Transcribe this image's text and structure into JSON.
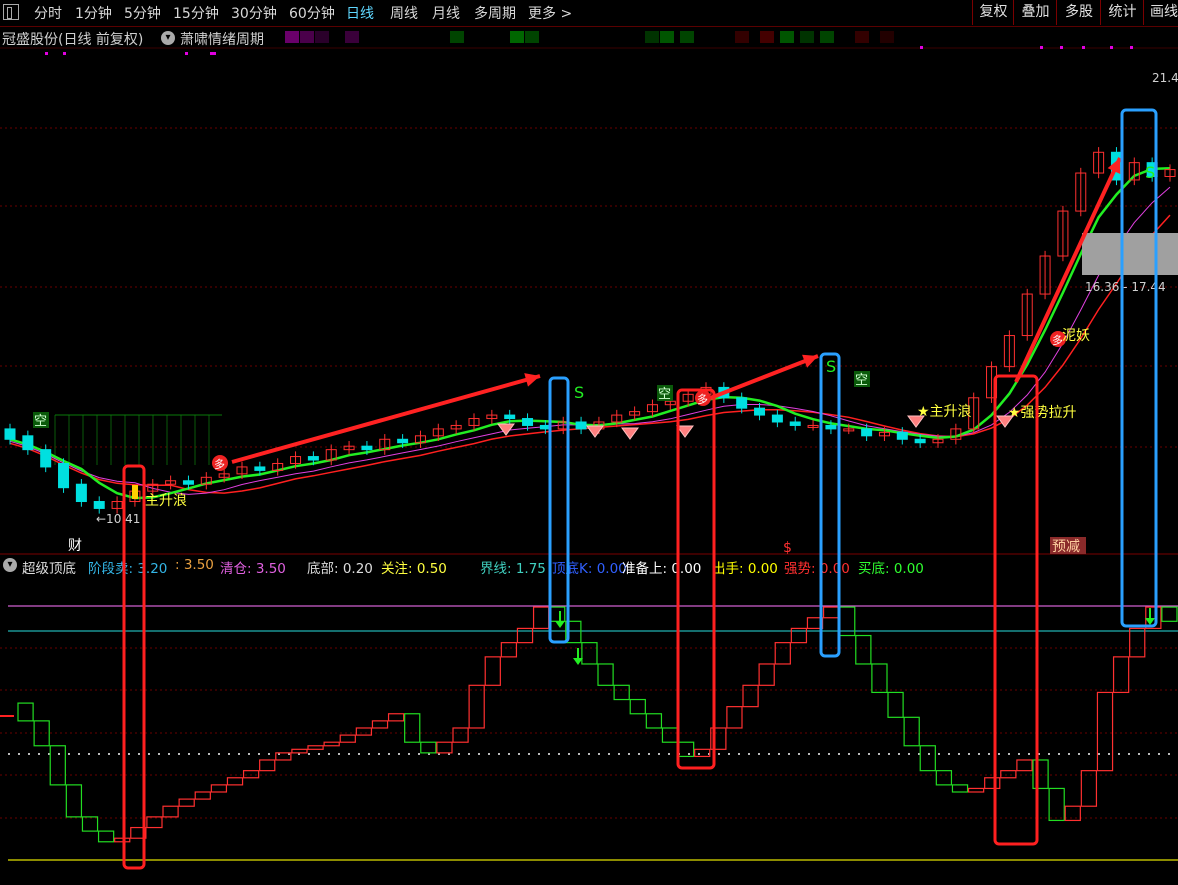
{
  "toolbar": {
    "periods": [
      "分时",
      "1分钟",
      "5分钟",
      "15分钟",
      "30分钟",
      "60分钟",
      "日线",
      "周线",
      "月线",
      "多周期",
      "更多 >"
    ],
    "active_period": "日线",
    "right_buttons": [
      "复权",
      "叠加",
      "多股",
      "统计",
      "画线"
    ]
  },
  "title": {
    "stock": "冠盛股份(日线 前复权)",
    "indicator_name": "萧啸情绪周期"
  },
  "price_panel": {
    "high_label": "21.4",
    "range_label": "16.36 - 17.44",
    "low_label": "←10.41",
    "markers": {
      "cai": "财",
      "dollar": "$",
      "yujian": "预减",
      "kong": "空",
      "duo": "多",
      "s": "S",
      "main_wave": "主升浪",
      "star_main_wave": "★主升浪",
      "strong_up": "★强势拉升",
      "niyao": "泥妖"
    }
  },
  "indicator": {
    "name": "超级顶底",
    "fields": [
      {
        "label": "阶段卖:",
        "value": "3.20",
        "color": "#33b5e5"
      },
      {
        "label": ":",
        "value": "3.50",
        "color": "#e8a040"
      },
      {
        "label": "清仓:",
        "value": "3.50",
        "color": "#e060e0"
      },
      {
        "label": "底部:",
        "value": "0.20",
        "color": "#dddddd"
      },
      {
        "label": "关注:",
        "value": "0.50",
        "color": "#ffff40"
      },
      {
        "label": "界线:",
        "value": "1.75",
        "color": "#40d0c0"
      },
      {
        "label": "顶底K:",
        "value": "0.00",
        "color": "#3060ff"
      },
      {
        "label": "准备上:",
        "value": "0.00",
        "color": "#ffffff"
      },
      {
        "label": "出手:",
        "value": "0.00",
        "color": "#ffff00"
      },
      {
        "label": "强势:",
        "value": "0.00",
        "color": "#ff3030"
      },
      {
        "label": "买底:",
        "value": "0.00",
        "color": "#30ff30"
      }
    ]
  },
  "colors": {
    "up": "#ff3030",
    "down": "#00e0e0",
    "ma_green": "#22ee22",
    "ma_red": "#ff2020",
    "ma_magenta": "#e040e0",
    "box_red": "#ff2020",
    "box_blue": "#2aa0ff",
    "level_magenta": "#d060d0",
    "level_cyan": "#20b0b0",
    "level_yellow": "#e0e000"
  },
  "chart_data": [
    {
      "type": "candlestick",
      "title": "冠盛股份(日线 前复权)",
      "price_range": [
        10.41,
        21.4
      ],
      "series": [
        {
          "name": "candles",
          "values": [
            [
              12.9,
              12.6
            ],
            [
              12.7,
              12.3
            ],
            [
              12.3,
              11.8
            ],
            [
              11.9,
              11.2
            ],
            [
              11.3,
              10.8
            ],
            [
              10.8,
              10.6
            ],
            [
              10.6,
              10.8
            ],
            [
              10.8,
              11.1
            ],
            [
              11.1,
              11.3
            ],
            [
              11.3,
              11.4
            ],
            [
              11.4,
              11.3
            ],
            [
              11.3,
              11.5
            ],
            [
              11.5,
              11.6
            ],
            [
              11.6,
              11.8
            ],
            [
              11.8,
              11.7
            ],
            [
              11.7,
              11.9
            ],
            [
              11.9,
              12.1
            ],
            [
              12.1,
              12.0
            ],
            [
              12.0,
              12.3
            ],
            [
              12.3,
              12.4
            ],
            [
              12.4,
              12.3
            ],
            [
              12.3,
              12.6
            ],
            [
              12.6,
              12.5
            ],
            [
              12.5,
              12.7
            ],
            [
              12.7,
              12.9
            ],
            [
              12.9,
              13.0
            ],
            [
              13.0,
              13.2
            ],
            [
              13.2,
              13.3
            ],
            [
              13.3,
              13.2
            ],
            [
              13.2,
              13.0
            ],
            [
              13.0,
              12.9
            ],
            [
              12.9,
              13.1
            ],
            [
              13.1,
              12.9
            ],
            [
              12.9,
              13.1
            ],
            [
              13.1,
              13.3
            ],
            [
              13.3,
              13.4
            ],
            [
              13.4,
              13.6
            ],
            [
              13.6,
              13.7
            ],
            [
              13.7,
              13.9
            ],
            [
              13.9,
              14.1
            ],
            [
              14.1,
              13.8
            ],
            [
              13.8,
              13.5
            ],
            [
              13.5,
              13.3
            ],
            [
              13.3,
              13.1
            ],
            [
              13.1,
              13.0
            ],
            [
              13.0,
              13.0
            ],
            [
              13.0,
              12.9
            ],
            [
              12.9,
              12.9
            ],
            [
              12.9,
              12.7
            ],
            [
              12.7,
              12.8
            ],
            [
              12.8,
              12.6
            ],
            [
              12.6,
              12.5
            ],
            [
              12.5,
              12.6
            ],
            [
              12.6,
              12.9
            ],
            [
              12.9,
              13.8
            ],
            [
              13.8,
              14.7
            ],
            [
              14.7,
              15.6
            ],
            [
              15.6,
              16.8
            ],
            [
              16.8,
              17.9
            ],
            [
              17.9,
              19.2
            ],
            [
              19.2,
              20.3
            ],
            [
              20.3,
              20.9
            ],
            [
              20.9,
              20.1
            ],
            [
              20.1,
              20.6
            ],
            [
              20.6,
              20.2
            ],
            [
              20.2,
              20.4
            ]
          ]
        }
      ]
    },
    {
      "type": "bar",
      "title": "超级顶底",
      "ylim": [
        0,
        3.5
      ],
      "levels": {
        "清仓": 3.5,
        "阶段卖": 3.2,
        "界线": 1.75,
        "关注": 0.5,
        "底部": 0.2
      },
      "series": [
        {
          "name": "stair",
          "values": [
            1.9,
            1.55,
            1.0,
            0.55,
            0.35,
            0.2,
            0.25,
            0.4,
            0.55,
            0.7,
            0.8,
            0.9,
            1.0,
            1.1,
            1.2,
            1.35,
            1.45,
            1.5,
            1.55,
            1.6,
            1.7,
            1.8,
            1.9,
            2.0,
            1.6,
            1.45,
            1.6,
            1.8,
            2.4,
            2.8,
            3.0,
            3.2,
            3.5,
            3.3,
            3.0,
            2.7,
            2.4,
            2.2,
            2.0,
            1.8,
            1.6,
            1.4,
            1.5,
            1.8,
            2.1,
            2.4,
            2.7,
            3.0,
            3.2,
            3.35,
            3.5,
            3.1,
            2.7,
            2.3,
            1.95,
            1.55,
            1.2,
            1.0,
            0.9,
            0.95,
            1.1,
            1.2,
            1.35,
            0.95,
            0.5,
            0.7,
            1.2,
            2.3,
            2.8,
            3.2,
            3.5,
            3.3
          ]
        }
      ]
    }
  ]
}
